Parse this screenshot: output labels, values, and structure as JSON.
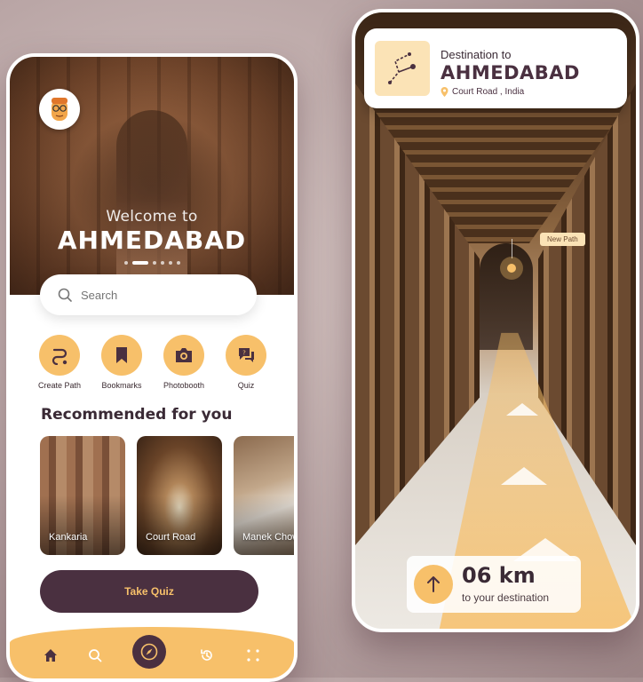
{
  "colors": {
    "accent": "#f7c06a",
    "dark": "#4a3040",
    "soft_accent": "#fbe3b6"
  },
  "home": {
    "welcome": "Welcome to",
    "city": "AHMEDABAD",
    "search": {
      "placeholder": "Search"
    },
    "actions": [
      {
        "label": "Create Path",
        "icon": "route-icon"
      },
      {
        "label": "Bookmarks",
        "icon": "bookmark-icon"
      },
      {
        "label": "Photobooth",
        "icon": "camera-icon"
      },
      {
        "label": "Quiz",
        "icon": "quiz-chat-icon"
      }
    ],
    "recommended_title": "Recommended for you",
    "recommended": [
      {
        "label": "Kankaria"
      },
      {
        "label": "Court Road"
      },
      {
        "label": "Manek Chowk"
      }
    ],
    "quiz_button": "Take Quiz",
    "nav": [
      "home-icon",
      "search-icon",
      "compass-icon",
      "history-icon",
      "grid-icon"
    ]
  },
  "navigation": {
    "destination_label": "Destination to",
    "destination_city": "AHMEDABAD",
    "destination_address": "Court Road , India",
    "new_path_label": "New Path",
    "distance": "06 km",
    "distance_sub": "to your destination"
  }
}
